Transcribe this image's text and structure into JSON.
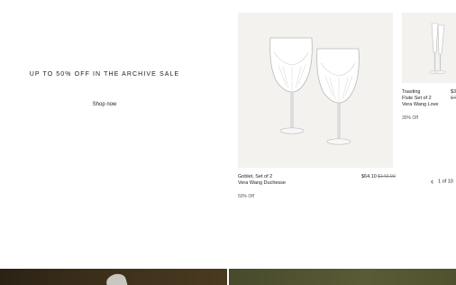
{
  "promo": {
    "title": "UP TO 50% OFF IN THE ARCHIVE SALE",
    "cta": "Shop now"
  },
  "products": [
    {
      "name": "Goblet, Set of 2",
      "brand": "Vera Wang Duchesse",
      "price": "$64.10",
      "old_price": "$143.00",
      "badge": "50% Off",
      "image_icon": "wine-goblet-pair-icon"
    },
    {
      "name_line1": "Toasting",
      "name_line2": "Flute Set of 2",
      "brand": "Vera Wang Love",
      "price": "$3",
      "old_price": "$4",
      "badge": "30% Off",
      "image_icon": "champagne-flute-pair-icon"
    }
  ],
  "pager": {
    "prev_icon": "chevron-left-icon",
    "text": "1 of 10"
  },
  "colors": {
    "card_bg": "#f3f2ef",
    "text": "#222222",
    "strike": "#888888"
  }
}
